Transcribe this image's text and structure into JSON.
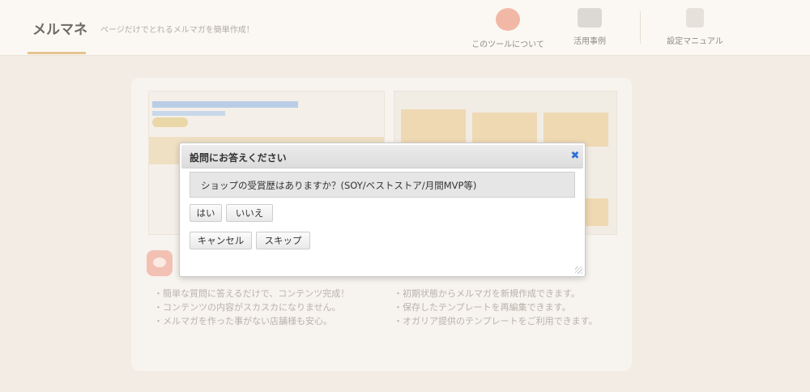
{
  "header": {
    "brand": "メルマネ",
    "tagline": "ページだけでとれるメルマガを簡単作成！",
    "nav": [
      {
        "label": "このツールについて",
        "icon": "bowl-icon"
      },
      {
        "label": "活用事例",
        "icon": "screenshot-icon"
      },
      {
        "label": "設定マニュアル",
        "icon": "book-icon"
      }
    ]
  },
  "features": {
    "left": [
      "・簡単な質問に答えるだけで、コンテンツ完成！",
      "・コンテンツの内容がスカスカになりません。",
      "・メルマガを作った事がない店舗様も安心。"
    ],
    "right": [
      "・初期状態からメルマガを新規作成できます。",
      "・保存したテンプレートを再編集できます。",
      "・オガリア提供のテンプレートをご利用できます。"
    ]
  },
  "dialog": {
    "title": "設問にお答えください",
    "close_glyph": "✖",
    "question": "ショップの受賞歴はありますか？(SOY/ベストストア/月間MVP等)",
    "answers": {
      "yes": "はい",
      "no": "いいえ"
    },
    "actions": {
      "cancel": "キャンセル",
      "skip": "スキップ"
    }
  },
  "colors": {
    "accent_close": "#2e6fd8",
    "page_bg": "#f3ece4",
    "dialog_header": "#dcdcdc"
  }
}
